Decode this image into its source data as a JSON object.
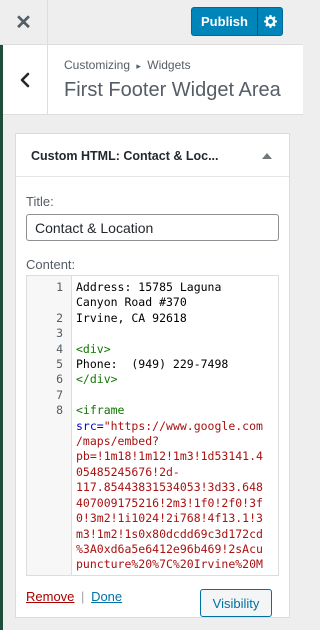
{
  "topbar": {
    "close_icon": "close-x-icon",
    "publish_label": "Publish",
    "settings_icon": "gear-icon"
  },
  "section": {
    "back_icon": "chevron-left-icon",
    "breadcrumb_parts": [
      "Customizing",
      "Widgets"
    ],
    "breadcrumb_separator": "▸",
    "title": "First Footer Widget Area"
  },
  "widget": {
    "header_title": "Custom HTML: Contact & Loc...",
    "toggle_icon": "arrow-up-icon",
    "title_label": "Title:",
    "title_value": "Contact & Location",
    "content_label": "Content:",
    "code_lines": [
      {
        "num": "1",
        "parts": [
          {
            "t": "Address: 15785 Laguna",
            "c": ""
          }
        ]
      },
      {
        "num": "",
        "parts": [
          {
            "t": "Canyon Road #370",
            "c": ""
          }
        ]
      },
      {
        "num": "2",
        "parts": [
          {
            "t": "Irvine, CA 92618",
            "c": ""
          }
        ]
      },
      {
        "num": "3",
        "parts": [
          {
            "t": "",
            "c": ""
          }
        ]
      },
      {
        "num": "4",
        "parts": [
          {
            "t": "<div>",
            "c": "c-tag"
          }
        ]
      },
      {
        "num": "5",
        "parts": [
          {
            "t": "Phone:  (949) 229-7498",
            "c": ""
          }
        ]
      },
      {
        "num": "6",
        "parts": [
          {
            "t": "</div>",
            "c": "c-tag"
          }
        ]
      },
      {
        "num": "7",
        "parts": [
          {
            "t": "",
            "c": ""
          }
        ]
      },
      {
        "num": "8",
        "parts": [
          {
            "t": "<iframe",
            "c": "c-tag"
          }
        ]
      },
      {
        "num": "",
        "parts": [
          {
            "t": "src=",
            "c": "c-attr"
          },
          {
            "t": "\"https://www.google.com",
            "c": "c-str"
          }
        ]
      },
      {
        "num": "",
        "parts": [
          {
            "t": "/maps/embed?",
            "c": "c-str"
          }
        ]
      },
      {
        "num": "",
        "parts": [
          {
            "t": "pb=!1m18!1m12!1m3!1d53141.4",
            "c": "c-str"
          }
        ]
      },
      {
        "num": "",
        "parts": [
          {
            "t": "05485245676!2d-",
            "c": "c-str"
          }
        ]
      },
      {
        "num": "",
        "parts": [
          {
            "t": "117.85443831534053!3d33.648",
            "c": "c-str"
          }
        ]
      },
      {
        "num": "",
        "parts": [
          {
            "t": "407009175216!2m3!1f0!2f0!3f",
            "c": "c-str"
          }
        ]
      },
      {
        "num": "",
        "parts": [
          {
            "t": "0!3m2!1i1024!2i768!4f13.1!3",
            "c": "c-str"
          }
        ]
      },
      {
        "num": "",
        "parts": [
          {
            "t": "m3!1m2!1s0x80dcdd69c3d172cd",
            "c": "c-str"
          }
        ]
      },
      {
        "num": "",
        "parts": [
          {
            "t": "%3A0xd6a5e6412e96b469!2sAcu",
            "c": "c-str"
          }
        ]
      },
      {
        "num": "",
        "parts": [
          {
            "t": "puncture%20%7C%20Irvine%20M",
            "c": "c-str"
          }
        ]
      }
    ],
    "remove_label": "Remove",
    "separator": "|",
    "done_label": "Done",
    "visibility_label": "Visibility"
  },
  "colors": {
    "primary": "#0085ba",
    "link": "#0073aa",
    "remove": "#aa0000",
    "edge": "#1e4d3a"
  }
}
